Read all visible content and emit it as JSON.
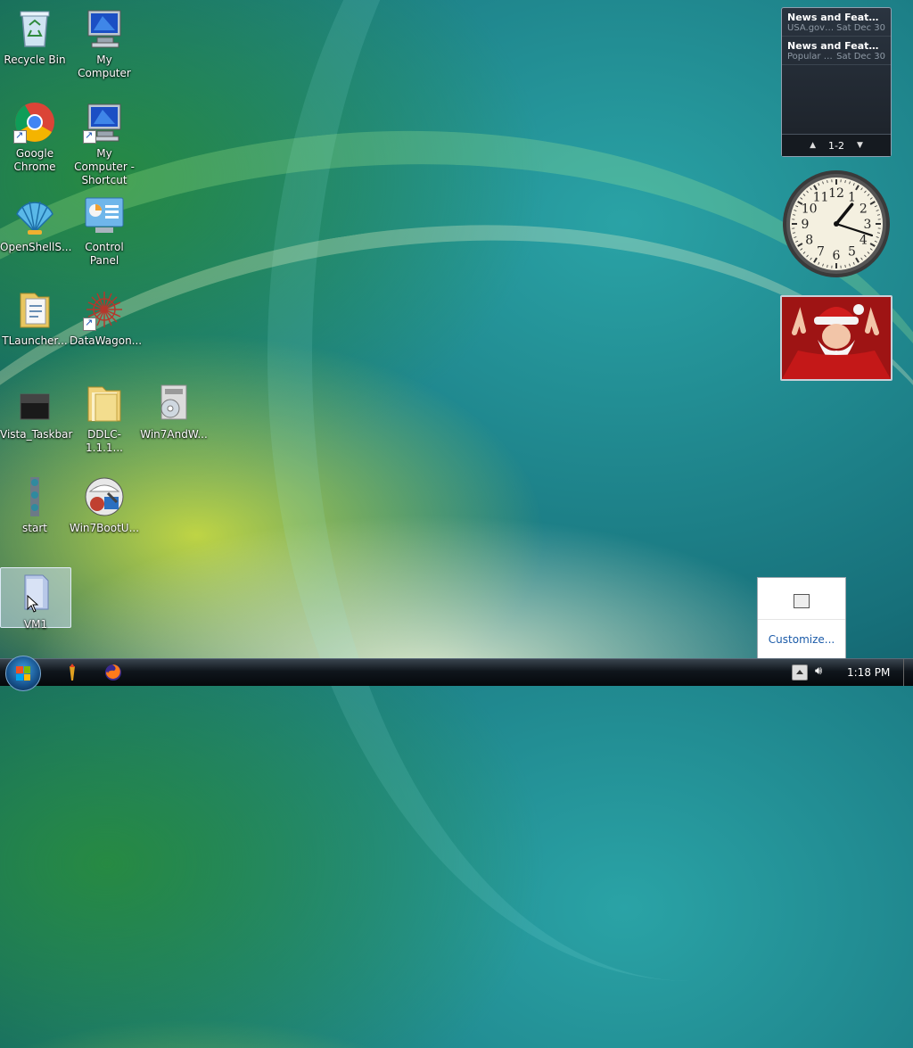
{
  "desktop": {
    "icons": [
      {
        "label": "Recycle Bin"
      },
      {
        "label": "My Computer"
      },
      {
        "label": "Google Chrome"
      },
      {
        "label": "My Computer - Shortcut"
      },
      {
        "label": "OpenShellS..."
      },
      {
        "label": "Control Panel"
      },
      {
        "label": "TLauncher..."
      },
      {
        "label": "DataWagon..."
      },
      {
        "label": "Vista_Taskbar"
      },
      {
        "label": "DDLC-1.1.1..."
      },
      {
        "label": "Win7AndW..."
      },
      {
        "label": "start"
      },
      {
        "label": "Win7BootU..."
      },
      {
        "label": "VM1"
      }
    ]
  },
  "gadgets": {
    "feed": {
      "items": [
        {
          "title": "News and Features f...",
          "source": "USA.gov U...",
          "date": "Sat Dec 30"
        },
        {
          "title": "News and Feature...",
          "source": "Popular G...",
          "date": "Sat Dec 30"
        }
      ],
      "page": "1-2"
    },
    "clock": {
      "hour": 1,
      "minute": 18
    }
  },
  "popup": {
    "customize": "Customize..."
  },
  "taskbar": {
    "time": "1:18 PM"
  },
  "colors": {
    "link": "#1a5aa8",
    "desktop_teal": "#17707a"
  }
}
